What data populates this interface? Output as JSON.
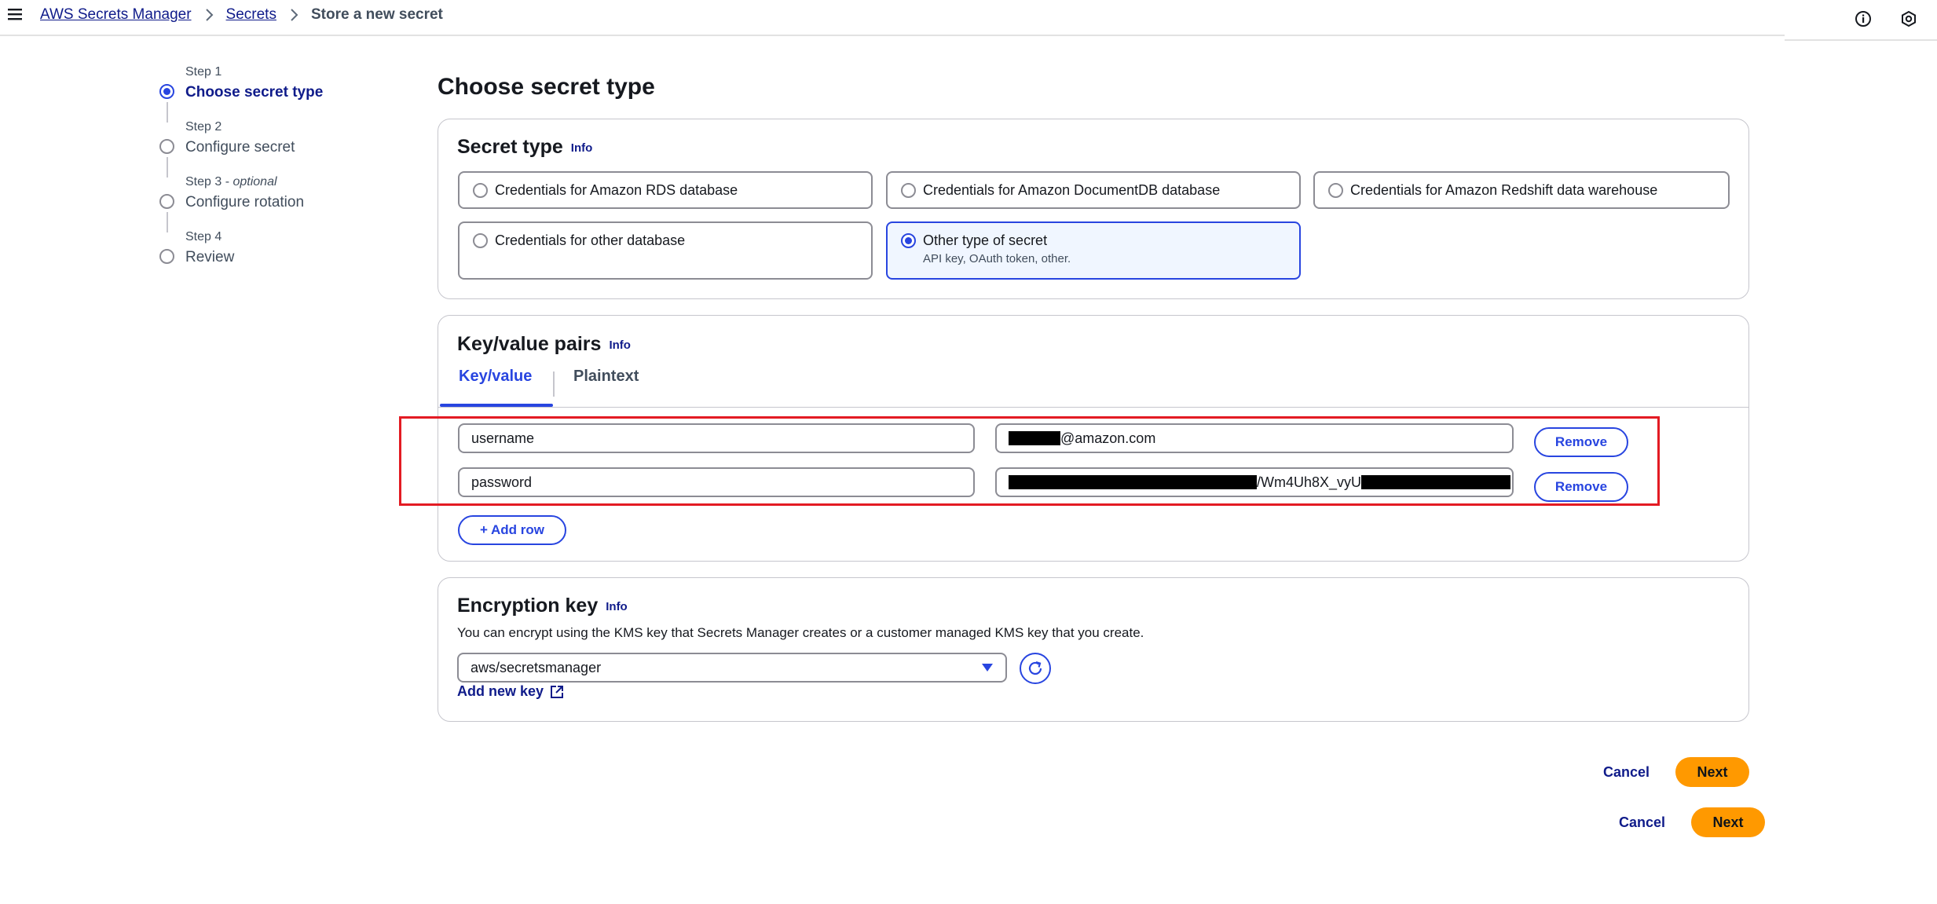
{
  "breadcrumb": {
    "items": [
      "AWS Secrets Manager",
      "Secrets"
    ],
    "current": "Store a new secret"
  },
  "steps": [
    {
      "label": "Step 1",
      "optional": "",
      "title": "Choose secret type",
      "active": true
    },
    {
      "label": "Step 2",
      "optional": "",
      "title": "Configure secret",
      "active": false
    },
    {
      "label": "Step 3 - ",
      "optional": "optional",
      "title": "Configure rotation",
      "active": false
    },
    {
      "label": "Step 4",
      "optional": "",
      "title": "Review",
      "active": false
    }
  ],
  "page_title": "Choose secret type",
  "secret_type": {
    "title": "Secret type",
    "info": "Info",
    "options": [
      {
        "label": "Credentials for Amazon RDS database",
        "desc": "",
        "selected": false
      },
      {
        "label": "Credentials for Amazon DocumentDB database",
        "desc": "",
        "selected": false
      },
      {
        "label": "Credentials for Amazon Redshift data warehouse",
        "desc": "",
        "selected": false
      },
      {
        "label": "Credentials for other database",
        "desc": "",
        "selected": false
      },
      {
        "label": "Other type of secret",
        "desc": "API key, OAuth token, other.",
        "selected": true
      }
    ]
  },
  "kv": {
    "title": "Key/value pairs",
    "info": "Info",
    "tabs": [
      "Key/value",
      "Plaintext"
    ],
    "active_tab": "Key/value",
    "rows": [
      {
        "key": "username",
        "value_visible": "@amazon.com"
      },
      {
        "key": "password",
        "value_visible_1": "/Wm4Uh8X_vyU"
      }
    ],
    "remove_label": "Remove",
    "add_row_label": "+ Add row"
  },
  "encryption": {
    "title": "Encryption key",
    "info": "Info",
    "helper": "You can encrypt using the KMS key that Secrets Manager creates or a customer managed KMS key that you create.",
    "selected_key": "aws/secretsmanager",
    "add_new_key": "Add new key"
  },
  "footer": {
    "cancel_label": "Cancel",
    "next_label": "Next"
  },
  "colors": {
    "accent": "#2845e0",
    "link": "#0f1b8a",
    "primary_button": "#ff9900",
    "highlight_box": "#e31b23"
  },
  "icons": [
    "menu-icon",
    "chevron-right-icon",
    "info-circle-icon",
    "settings-hex-icon",
    "refresh-icon",
    "external-link-icon",
    "caret-down-icon"
  ]
}
